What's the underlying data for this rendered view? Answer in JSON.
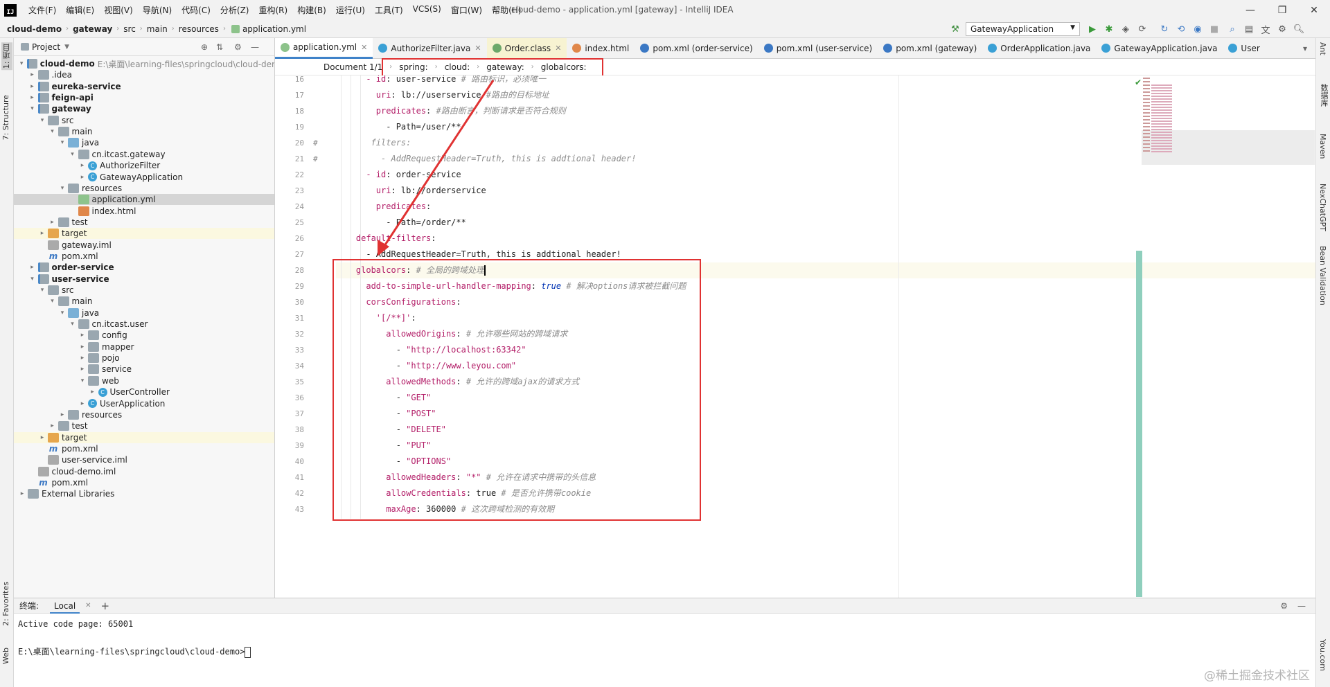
{
  "menu": {
    "logo": "IJ",
    "items": [
      "文件(F)",
      "编辑(E)",
      "视图(V)",
      "导航(N)",
      "代码(C)",
      "分析(Z)",
      "重构(R)",
      "构建(B)",
      "运行(U)",
      "工具(T)",
      "VCS(S)",
      "窗口(W)",
      "帮助(H)"
    ],
    "window_title": "cloud-demo - application.yml [gateway] - IntelliJ IDEA"
  },
  "nav": {
    "crumbs": [
      "cloud-demo",
      "gateway",
      "src",
      "main",
      "resources",
      "application.yml"
    ],
    "run_config": "GatewayApplication"
  },
  "left_stripe": {
    "project": "1: 项目",
    "structure": "7: Structure",
    "favorites": "2: Favorites",
    "web": "Web"
  },
  "right_stripe": {
    "ant": "Ant",
    "db": "数据库",
    "maven": "Maven",
    "chatgpt": "NexChatGPT",
    "bean": "Bean Validation",
    "youcom": "You.com"
  },
  "project": {
    "title": "Project",
    "root_path": "E:\\桌面\\learning-files\\springcloud\\cloud-der",
    "nodes": [
      {
        "label": "cloud-demo",
        "depth": 0,
        "icon": "mod",
        "open": true,
        "bold": true
      },
      {
        "label": ".idea",
        "depth": 1,
        "icon": "fold",
        "open": false
      },
      {
        "label": "eureka-service",
        "depth": 1,
        "icon": "mod",
        "open": false,
        "bold": true
      },
      {
        "label": "feign-api",
        "depth": 1,
        "icon": "mod",
        "open": false,
        "bold": true
      },
      {
        "label": "gateway",
        "depth": 1,
        "icon": "mod",
        "open": true,
        "bold": true
      },
      {
        "label": "src",
        "depth": 2,
        "icon": "fold",
        "open": true
      },
      {
        "label": "main",
        "depth": 3,
        "icon": "fold",
        "open": true
      },
      {
        "label": "java",
        "depth": 4,
        "icon": "fold-b",
        "open": true
      },
      {
        "label": "cn.itcast.gateway",
        "depth": 5,
        "icon": "fold",
        "open": true
      },
      {
        "label": "AuthorizeFilter",
        "depth": 6,
        "icon": "cls",
        "open": false
      },
      {
        "label": "GatewayApplication",
        "depth": 6,
        "icon": "cls",
        "open": false
      },
      {
        "label": "resources",
        "depth": 4,
        "icon": "fold",
        "open": true
      },
      {
        "label": "application.yml",
        "depth": 5,
        "icon": "yml",
        "leaf": true,
        "sel": true
      },
      {
        "label": "index.html",
        "depth": 5,
        "icon": "html",
        "leaf": true
      },
      {
        "label": "test",
        "depth": 3,
        "icon": "fold",
        "open": false
      },
      {
        "label": "target",
        "depth": 2,
        "icon": "fold-o",
        "open": false,
        "tgt": true
      },
      {
        "label": "gateway.iml",
        "depth": 2,
        "icon": "iml",
        "leaf": true
      },
      {
        "label": "pom.xml",
        "depth": 2,
        "icon": "mvn",
        "leaf": true
      },
      {
        "label": "order-service",
        "depth": 1,
        "icon": "mod",
        "open": false,
        "bold": true
      },
      {
        "label": "user-service",
        "depth": 1,
        "icon": "mod",
        "open": true,
        "bold": true
      },
      {
        "label": "src",
        "depth": 2,
        "icon": "fold",
        "open": true
      },
      {
        "label": "main",
        "depth": 3,
        "icon": "fold",
        "open": true
      },
      {
        "label": "java",
        "depth": 4,
        "icon": "fold-b",
        "open": true
      },
      {
        "label": "cn.itcast.user",
        "depth": 5,
        "icon": "fold",
        "open": true
      },
      {
        "label": "config",
        "depth": 6,
        "icon": "fold",
        "open": false
      },
      {
        "label": "mapper",
        "depth": 6,
        "icon": "fold",
        "open": false
      },
      {
        "label": "pojo",
        "depth": 6,
        "icon": "fold",
        "open": false
      },
      {
        "label": "service",
        "depth": 6,
        "icon": "fold",
        "open": false
      },
      {
        "label": "web",
        "depth": 6,
        "icon": "fold",
        "open": true
      },
      {
        "label": "UserController",
        "depth": 7,
        "icon": "cls",
        "open": false
      },
      {
        "label": "UserApplication",
        "depth": 6,
        "icon": "cls",
        "open": false
      },
      {
        "label": "resources",
        "depth": 4,
        "icon": "fold",
        "open": false
      },
      {
        "label": "test",
        "depth": 3,
        "icon": "fold",
        "open": false
      },
      {
        "label": "target",
        "depth": 2,
        "icon": "fold-o",
        "open": false,
        "tgt": true
      },
      {
        "label": "pom.xml",
        "depth": 2,
        "icon": "mvn",
        "leaf": true
      },
      {
        "label": "user-service.iml",
        "depth": 2,
        "icon": "iml",
        "leaf": true
      },
      {
        "label": "cloud-demo.iml",
        "depth": 1,
        "icon": "iml",
        "leaf": true
      },
      {
        "label": "pom.xml",
        "depth": 1,
        "icon": "mvn",
        "leaf": true
      },
      {
        "label": "External Libraries",
        "depth": 0,
        "icon": "fold",
        "open": false
      }
    ]
  },
  "tabs": [
    {
      "label": "application.yml",
      "color": "#8dc38b",
      "active": true
    },
    {
      "label": "AuthorizeFilter.java",
      "color": "#3aa0d5"
    },
    {
      "label": "Order.class",
      "color": "#6ca86a",
      "bg": "#f7f3d2"
    },
    {
      "label": "index.html",
      "color": "#e0874a"
    },
    {
      "label": "pom.xml (order-service)",
      "color": "#3b78c4"
    },
    {
      "label": "pom.xml (user-service)",
      "color": "#3b78c4"
    },
    {
      "label": "pom.xml (gateway)",
      "color": "#3b78c4"
    },
    {
      "label": "OrderApplication.java",
      "color": "#3aa0d5"
    },
    {
      "label": "GatewayApplication.java",
      "color": "#3aa0d5"
    },
    {
      "label": "User",
      "color": "#3aa0d5"
    }
  ],
  "breadcrumb": {
    "doc": "Document 1/1",
    "path": [
      "spring:",
      "cloud:",
      "gateway:",
      "globalcors:"
    ]
  },
  "code": {
    "lines": [
      {
        "n": "16",
        "seg": [
          [
            "      ",
            "d"
          ],
          [
            "- id",
            "k"
          ],
          [
            ": user-service ",
            "d"
          ],
          [
            "# 路由标识，必须唯一",
            "c"
          ]
        ]
      },
      {
        "n": "17",
        "seg": [
          [
            "        ",
            "d"
          ],
          [
            "uri",
            "k"
          ],
          [
            ": lb://userservice ",
            "d"
          ],
          [
            "#路由的目标地址",
            "c"
          ]
        ]
      },
      {
        "n": "18",
        "seg": [
          [
            "        ",
            "d"
          ],
          [
            "predicates",
            "k"
          ],
          [
            ": ",
            "d"
          ],
          [
            "#路由断言，判断请求是否符合规则",
            "c"
          ]
        ]
      },
      {
        "n": "19",
        "seg": [
          [
            "          - Path=/user/**",
            "d"
          ]
        ]
      },
      {
        "n": "20",
        "m": "#",
        "seg": [
          [
            "       filters:",
            "c"
          ]
        ]
      },
      {
        "n": "21",
        "m": "#",
        "seg": [
          [
            "         - AddRequestHeader=Truth, this is addtional header!",
            "c"
          ]
        ]
      },
      {
        "n": "22",
        "seg": [
          [
            "      ",
            "d"
          ],
          [
            "- id",
            "k"
          ],
          [
            ": order-service",
            "d"
          ]
        ]
      },
      {
        "n": "23",
        "seg": [
          [
            "        ",
            "d"
          ],
          [
            "uri",
            "k"
          ],
          [
            ": lb://orderservice",
            "d"
          ]
        ]
      },
      {
        "n": "24",
        "seg": [
          [
            "        ",
            "d"
          ],
          [
            "predicates",
            "k"
          ],
          [
            ":",
            "d"
          ]
        ]
      },
      {
        "n": "25",
        "seg": [
          [
            "          - Path=/order/**",
            "d"
          ]
        ]
      },
      {
        "n": "26",
        "seg": [
          [
            "    ",
            "d"
          ],
          [
            "default-filters",
            "k"
          ],
          [
            ":",
            "d"
          ]
        ]
      },
      {
        "n": "27",
        "seg": [
          [
            "      - AddRequestHeader=Truth, this is addtional header!",
            "d"
          ]
        ]
      },
      {
        "n": "28",
        "cur": true,
        "seg": [
          [
            "    ",
            "d"
          ],
          [
            "globalcors",
            "k"
          ],
          [
            ": ",
            "d"
          ],
          [
            "# 全局的跨域处理",
            "c"
          ]
        ]
      },
      {
        "n": "29",
        "seg": [
          [
            "      ",
            "d"
          ],
          [
            "add-to-simple-url-handler-mapping",
            "k"
          ],
          [
            ": ",
            "d"
          ],
          [
            "true",
            "v"
          ],
          [
            " ",
            "d"
          ],
          [
            "# 解决options请求被拦截问题",
            "c"
          ]
        ]
      },
      {
        "n": "30",
        "seg": [
          [
            "      ",
            "d"
          ],
          [
            "corsConfigurations",
            "k"
          ],
          [
            ":",
            "d"
          ]
        ]
      },
      {
        "n": "31",
        "seg": [
          [
            "        ",
            "d"
          ],
          [
            "'[/**]'",
            "k"
          ],
          [
            ":",
            "d"
          ]
        ]
      },
      {
        "n": "32",
        "seg": [
          [
            "          ",
            "d"
          ],
          [
            "allowedOrigins",
            "k"
          ],
          [
            ": ",
            "d"
          ],
          [
            "# 允许哪些网站的跨域请求",
            "c"
          ]
        ]
      },
      {
        "n": "33",
        "seg": [
          [
            "            - ",
            "d"
          ],
          [
            "\"http://localhost:63342\"",
            "k"
          ]
        ]
      },
      {
        "n": "34",
        "seg": [
          [
            "            - ",
            "d"
          ],
          [
            "\"http://www.leyou.com\"",
            "k"
          ]
        ]
      },
      {
        "n": "35",
        "seg": [
          [
            "          ",
            "d"
          ],
          [
            "allowedMethods",
            "k"
          ],
          [
            ": ",
            "d"
          ],
          [
            "# 允许的跨域ajax的请求方式",
            "c"
          ]
        ]
      },
      {
        "n": "36",
        "seg": [
          [
            "            - ",
            "d"
          ],
          [
            "\"GET\"",
            "k"
          ]
        ]
      },
      {
        "n": "37",
        "seg": [
          [
            "            - ",
            "d"
          ],
          [
            "\"POST\"",
            "k"
          ]
        ]
      },
      {
        "n": "38",
        "seg": [
          [
            "            - ",
            "d"
          ],
          [
            "\"DELETE\"",
            "k"
          ]
        ]
      },
      {
        "n": "39",
        "seg": [
          [
            "            - ",
            "d"
          ],
          [
            "\"PUT\"",
            "k"
          ]
        ]
      },
      {
        "n": "40",
        "seg": [
          [
            "            - ",
            "d"
          ],
          [
            "\"OPTIONS\"",
            "k"
          ]
        ]
      },
      {
        "n": "41",
        "seg": [
          [
            "          ",
            "d"
          ],
          [
            "allowedHeaders",
            "k"
          ],
          [
            ": ",
            "d"
          ],
          [
            "\"*\"",
            "k"
          ],
          [
            " ",
            "d"
          ],
          [
            "# 允许在请求中携带的头信息",
            "c"
          ]
        ]
      },
      {
        "n": "42",
        "seg": [
          [
            "          ",
            "d"
          ],
          [
            "allowCredentials",
            "k"
          ],
          [
            ": true ",
            "d"
          ],
          [
            "# 是否允许携带cookie",
            "c"
          ]
        ]
      },
      {
        "n": "43",
        "seg": [
          [
            "          ",
            "d"
          ],
          [
            "maxAge",
            "k"
          ],
          [
            ": 360000 ",
            "d"
          ],
          [
            "# 这次跨域检测的有效期",
            "c"
          ]
        ]
      }
    ]
  },
  "terminal": {
    "title": "终端:",
    "tab": "Local",
    "line1": "Active code page: 65001",
    "line2": "E:\\桌面\\learning-files\\springcloud\\cloud-demo>"
  },
  "watermark": "@稀土掘金技术社区",
  "colors": {
    "accent": "#4083c9",
    "highlight": "#e03232",
    "keyword": "#b31e68"
  }
}
